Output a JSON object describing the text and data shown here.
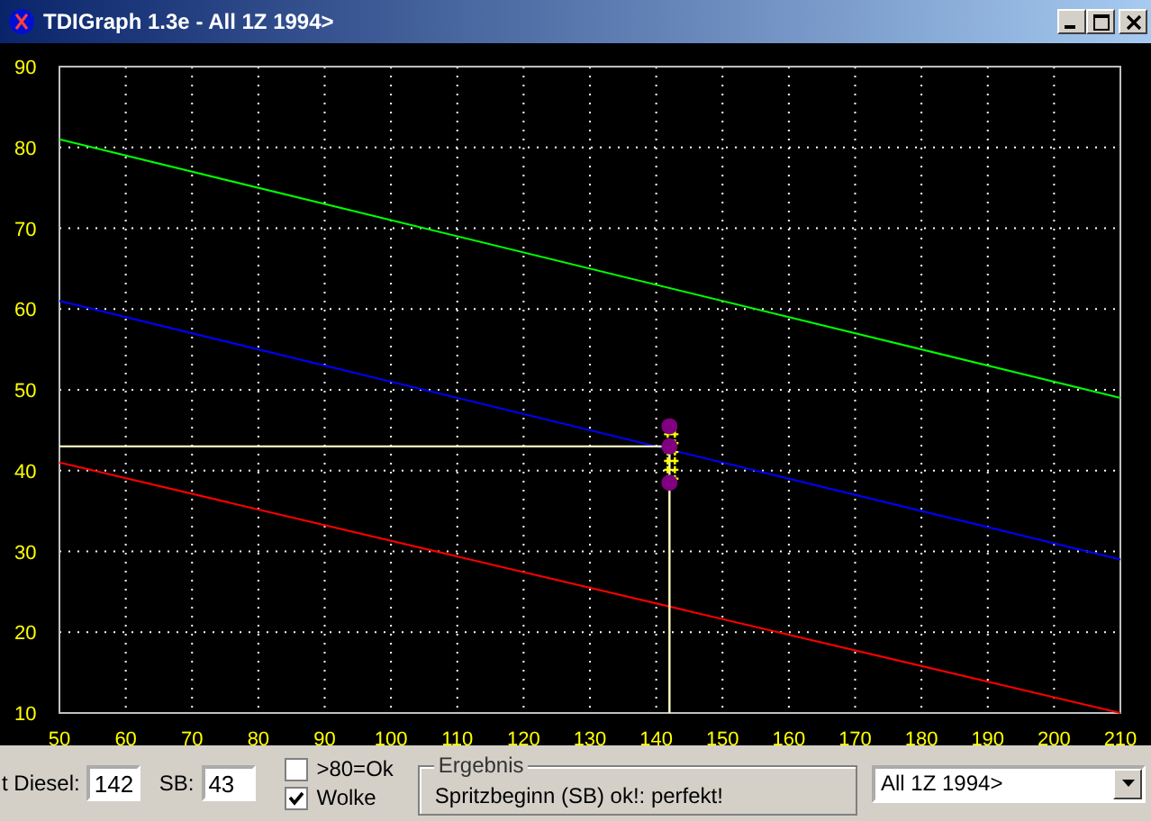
{
  "window": {
    "title": "TDIGraph 1.3e - All 1Z 1994>"
  },
  "chart": {
    "chart_data": {
      "type": "line",
      "x": [
        50,
        210
      ],
      "xlim": [
        50,
        210
      ],
      "ylim": [
        10,
        90
      ],
      "xticks": [
        50,
        60,
        70,
        80,
        90,
        100,
        110,
        120,
        130,
        140,
        150,
        160,
        170,
        180,
        190,
        200,
        210
      ],
      "yticks": [
        10,
        20,
        30,
        40,
        50,
        60,
        70,
        80,
        90
      ],
      "grid": true,
      "ref_lines": [
        {
          "axis": "y",
          "value": 43,
          "color": "#ffffc0"
        },
        {
          "axis": "x",
          "value": 142,
          "color": "#ffffc0"
        }
      ],
      "series": [
        {
          "color": "#00ff00",
          "values": [
            81,
            49
          ]
        },
        {
          "color": "#0000ff",
          "values": [
            61,
            29
          ]
        },
        {
          "color": "#ff0000",
          "values": [
            41,
            10
          ]
        }
      ]
    }
  },
  "controls": {
    "diesel_label": "t Diesel:",
    "diesel_value": "142",
    "sb_label": "SB:",
    "sb_value": "43",
    "checkboxes": [
      {
        "label": ">80=Ok",
        "checked": false
      },
      {
        "label": "Wolke",
        "checked": true
      }
    ],
    "result": {
      "title": "Ergebnis",
      "text": "Spritzbeginn (SB) ok!: perfekt!"
    },
    "profile": {
      "value": "All 1Z 1994>"
    }
  }
}
